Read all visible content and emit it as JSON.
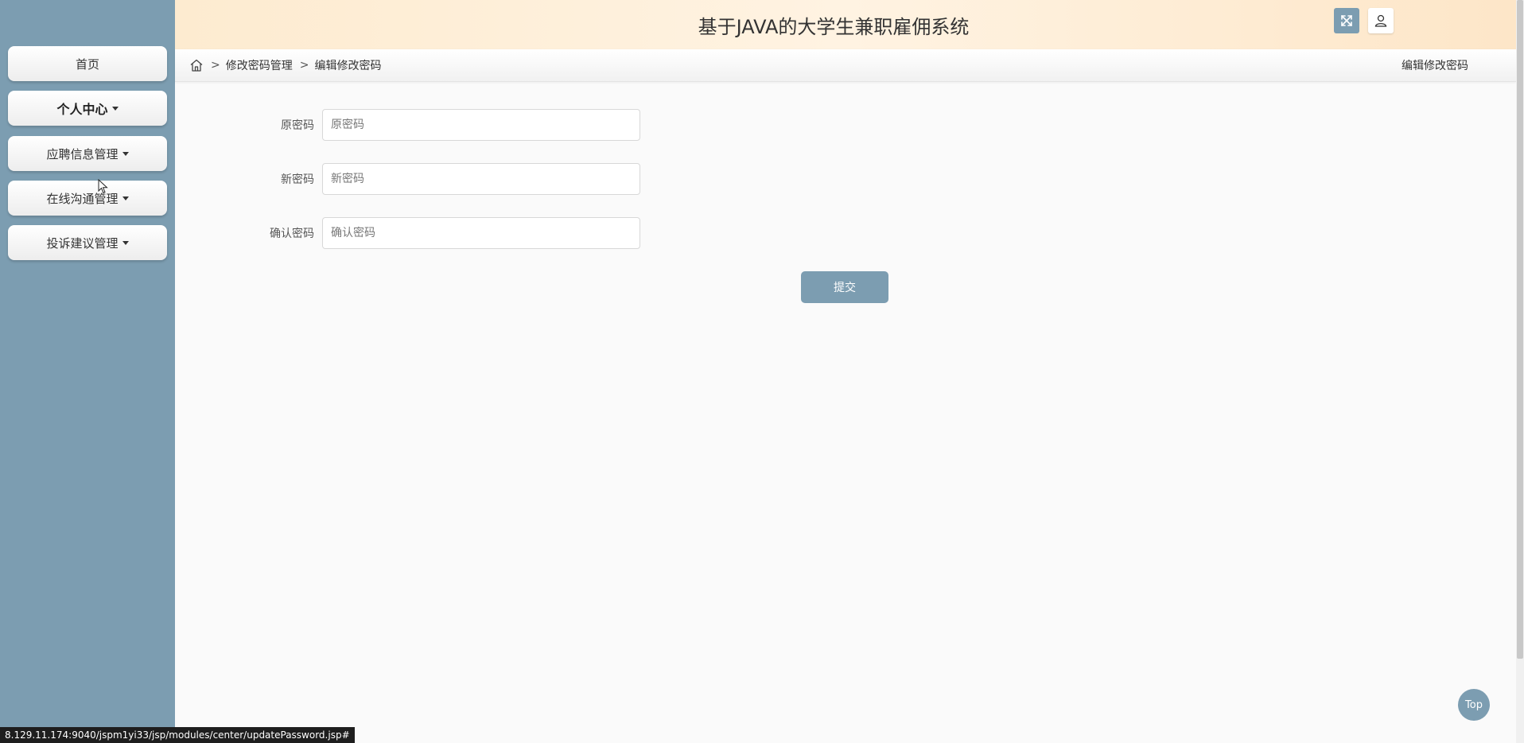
{
  "header": {
    "title": "基于JAVA的大学生兼职雇佣系统",
    "expand_icon": "fullscreen-icon",
    "user_icon": "user-icon"
  },
  "sidebar": {
    "items": [
      {
        "label": "首页",
        "dropdown": false
      },
      {
        "label": "个人中心",
        "dropdown": true
      },
      {
        "label": "应聘信息管理",
        "dropdown": true
      },
      {
        "label": "在线沟通管理",
        "dropdown": true
      },
      {
        "label": "投诉建议管理",
        "dropdown": true
      }
    ]
  },
  "breadcrumb": {
    "home_icon": "home-icon",
    "separator": ">",
    "items": [
      "修改密码管理",
      "编辑修改密码"
    ],
    "right_title": "编辑修改密码"
  },
  "form": {
    "fields": [
      {
        "label": "原密码",
        "placeholder": "原密码",
        "value": ""
      },
      {
        "label": "新密码",
        "placeholder": "新密码",
        "value": ""
      },
      {
        "label": "确认密码",
        "placeholder": "确认密码",
        "value": ""
      }
    ],
    "submit_label": "提交"
  },
  "top_button": "Top",
  "status_url": "8.129.11.174:9040/jspm1yi33/jsp/modules/center/updatePassword.jsp#",
  "colors": {
    "accent": "#7c9db1",
    "header_bg": "#fdebd0"
  }
}
